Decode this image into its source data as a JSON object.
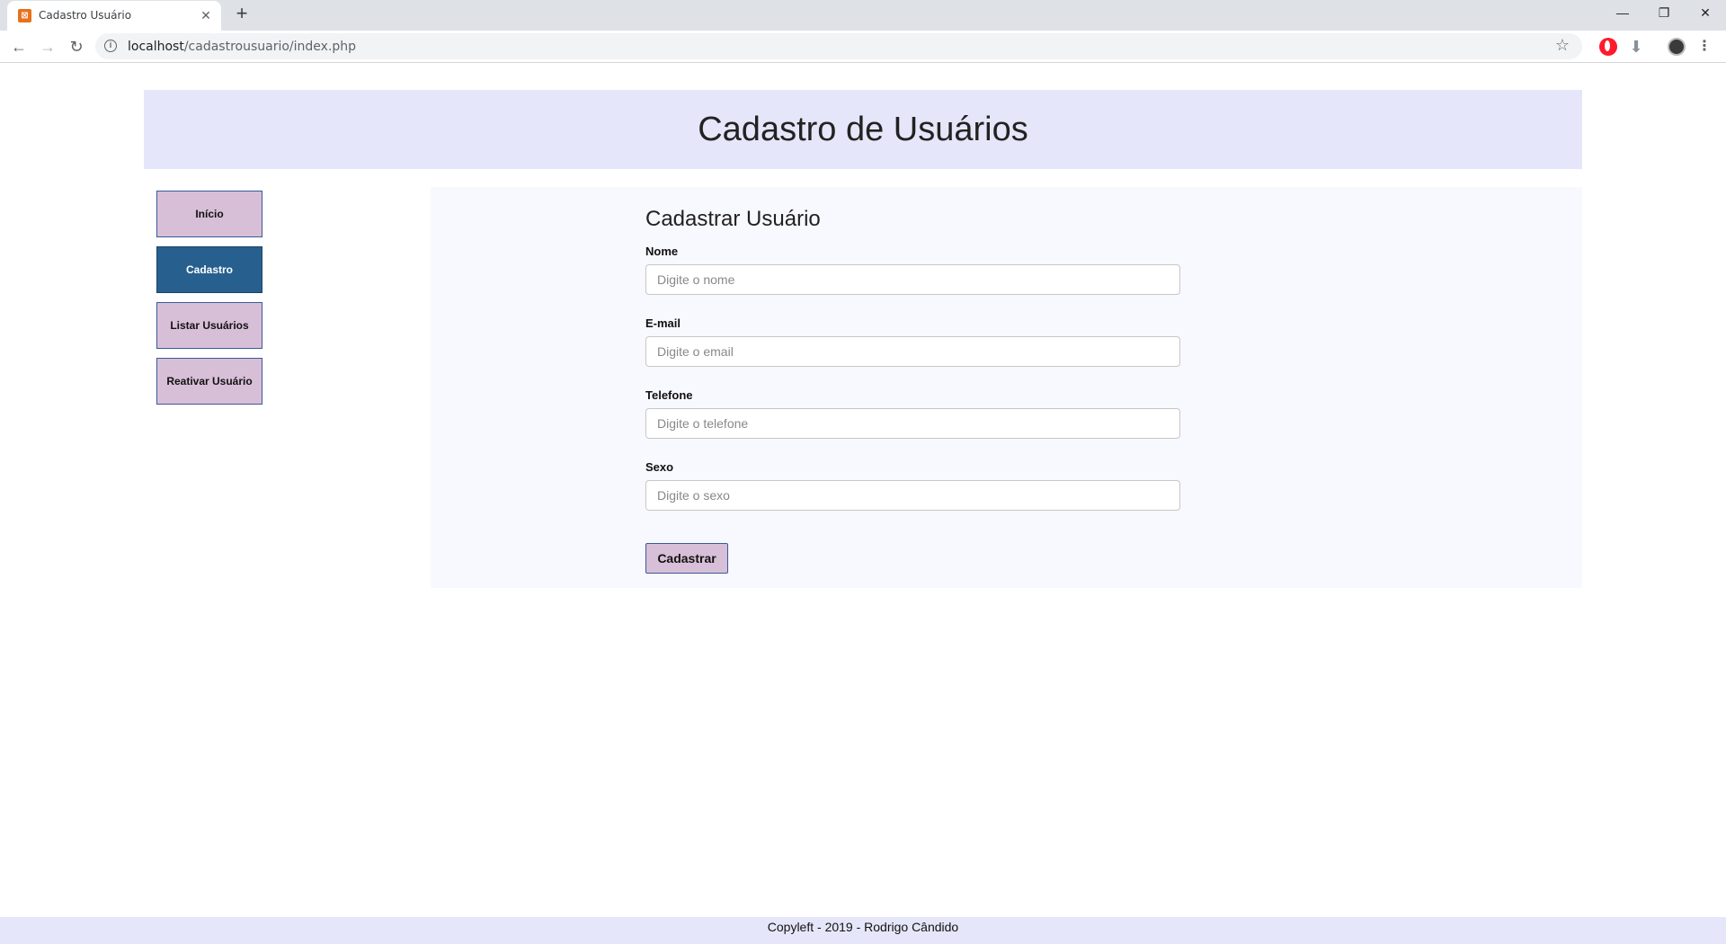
{
  "browser": {
    "tab_title": "Cadastro Usuário",
    "tab_close": "✕",
    "new_tab": "+",
    "url_host": "localhost",
    "url_path": "/cadastrousuario/index.php",
    "window_minimize": "—",
    "window_restore": "❐",
    "window_close": "✕"
  },
  "header": {
    "title": "Cadastro de Usuários"
  },
  "sidebar": {
    "items": [
      {
        "label": "Início",
        "active": false
      },
      {
        "label": "Cadastro",
        "active": true
      },
      {
        "label": "Listar Usuários",
        "active": false
      },
      {
        "label": "Reativar Usuário",
        "active": false
      }
    ]
  },
  "form": {
    "title": "Cadastrar Usuário",
    "fields": [
      {
        "label": "Nome",
        "placeholder": "Digite o nome",
        "value": ""
      },
      {
        "label": "E-mail",
        "placeholder": "Digite o email",
        "value": ""
      },
      {
        "label": "Telefone",
        "placeholder": "Digite o telefone",
        "value": ""
      },
      {
        "label": "Sexo",
        "placeholder": "Digite o sexo",
        "value": ""
      }
    ],
    "submit_label": "Cadastrar"
  },
  "footer": {
    "text": "Copyleft - 2019 - Rodrigo Cândido"
  },
  "colors": {
    "header_bg": "#e6e6fa",
    "nav_button_bg": "#d8bfd8",
    "nav_active_bg": "#27608f",
    "content_bg": "#f8f8ff"
  },
  "icons": {
    "back": "arrow-left-icon",
    "forward": "arrow-right-icon",
    "reload": "reload-icon",
    "info": "info-icon",
    "bookmark": "star-icon",
    "extension_opera": "opera-icon",
    "extension_download": "download-icon",
    "profile": "avatar-icon",
    "menu": "kebab-menu-icon"
  }
}
